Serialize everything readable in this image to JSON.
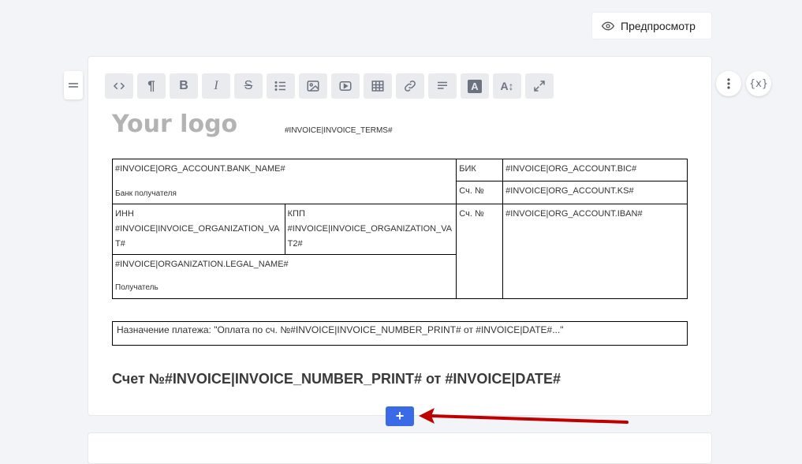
{
  "preview": {
    "label": "Предпросмотр",
    "icon": "eye-icon"
  },
  "toolbar": {
    "buttons": [
      "code-icon",
      "paragraph-icon",
      "bold-icon",
      "italic-icon",
      "strikethrough-icon",
      "list-icon",
      "image-icon",
      "video-icon",
      "table-icon",
      "link-icon",
      "align-icon",
      "text-color-icon",
      "font-size-icon",
      "fullscreen-icon"
    ],
    "bold_label": "B",
    "italic_label": "I",
    "strike_label": "S",
    "paragraph_label": "¶",
    "text_color_label": "A",
    "font_size_label": "A↕"
  },
  "variables_button": "{x}",
  "document": {
    "logo": "Your logo",
    "terms": "#INVOICE|INVOICE_TERMS#",
    "bank_name": "#INVOICE|ORG_ACCOUNT.BANK_NAME#",
    "bank_label": "Банк получателя",
    "bik_label": "БИК",
    "bik_value": "#INVOICE|ORG_ACCOUNT.BIC#",
    "ks_label": "Сч. №",
    "ks_value": "#INVOICE|ORG_ACCOUNT.KS#",
    "inn_label": "ИНН",
    "inn_value": "#INVOICE|INVOICE_ORGANIZATION_VAT#",
    "kpp_label": "КПП",
    "kpp_value": "#INVOICE|INVOICE_ORGANIZATION_VAT2#",
    "iban_label": "Сч. №",
    "iban_value": "#INVOICE|ORG_ACCOUNT.IBAN#",
    "legal_name": "#INVOICE|ORGANIZATION.LEGAL_NAME#",
    "recipient_label": "Получатель",
    "purpose": "Назначение платежа: \"Оплата по сч. №#INVOICE|INVOICE_NUMBER_PRINT# от #INVOICE|DATE#...\"",
    "heading": "Счет №#INVOICE|INVOICE_NUMBER_PRINT# от #INVOICE|DATE#"
  },
  "add_button": "+",
  "colors": {
    "accent": "#3b6ae6",
    "arrow": "#c00000"
  }
}
